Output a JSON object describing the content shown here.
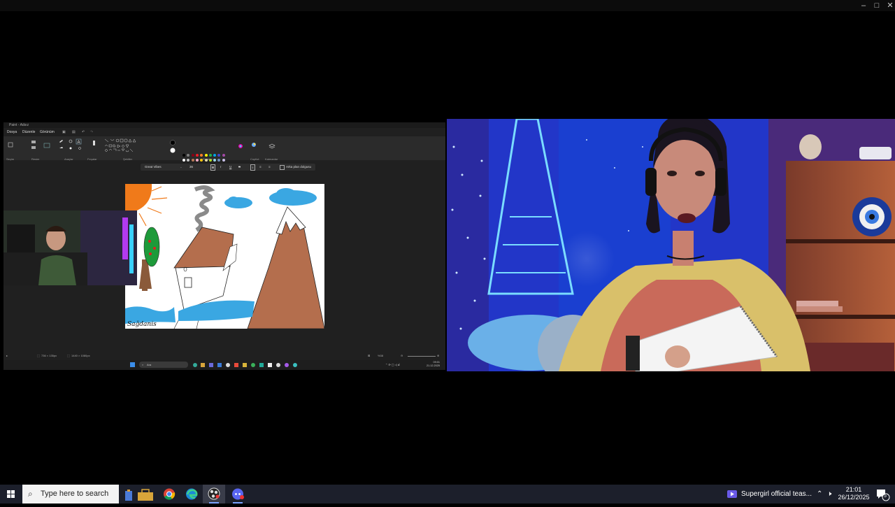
{
  "window_controls": {
    "minimize": "–",
    "maximize": "□",
    "close": "✕"
  },
  "paint": {
    "title": "Paint - Adsız",
    "menu": [
      "Dosya",
      "Düzenle",
      "Görünüm"
    ],
    "groups": [
      "Seçim",
      "Resim",
      "Araçlar",
      "Fırçalar",
      "Şekiller",
      "Renkler",
      "Copilot",
      "Katmanlar"
    ],
    "text_toolbar": {
      "font": "Great Vibes",
      "size": "36",
      "background_fill": "Arka plan dolgusu"
    },
    "signature": "Sağdanis",
    "status": {
      "selection": "736 × 135px",
      "canvas_size": "1440 × 1080px",
      "zoom": "%38"
    },
    "inner_taskbar": {
      "search": "Ara",
      "time": "09:01",
      "date": "21.12.2025"
    },
    "palette": [
      "#000000",
      "#7f7f7f",
      "#880015",
      "#ed1c24",
      "#ff7f27",
      "#fff200",
      "#22b14c",
      "#00a2e8",
      "#3f48cc",
      "#a349a4",
      "#ffffff",
      "#c3c3c3",
      "#b97a57",
      "#ffaec9",
      "#ffc90e",
      "#efe4b0",
      "#b5e61d",
      "#99d9ea",
      "#7092be",
      "#c8bfe7"
    ]
  },
  "taskbar": {
    "search_placeholder": "Type here to search",
    "media_title": "Supergirl official teas...",
    "time": "21:01",
    "date": "26/12/2025",
    "notification_count": "5"
  }
}
